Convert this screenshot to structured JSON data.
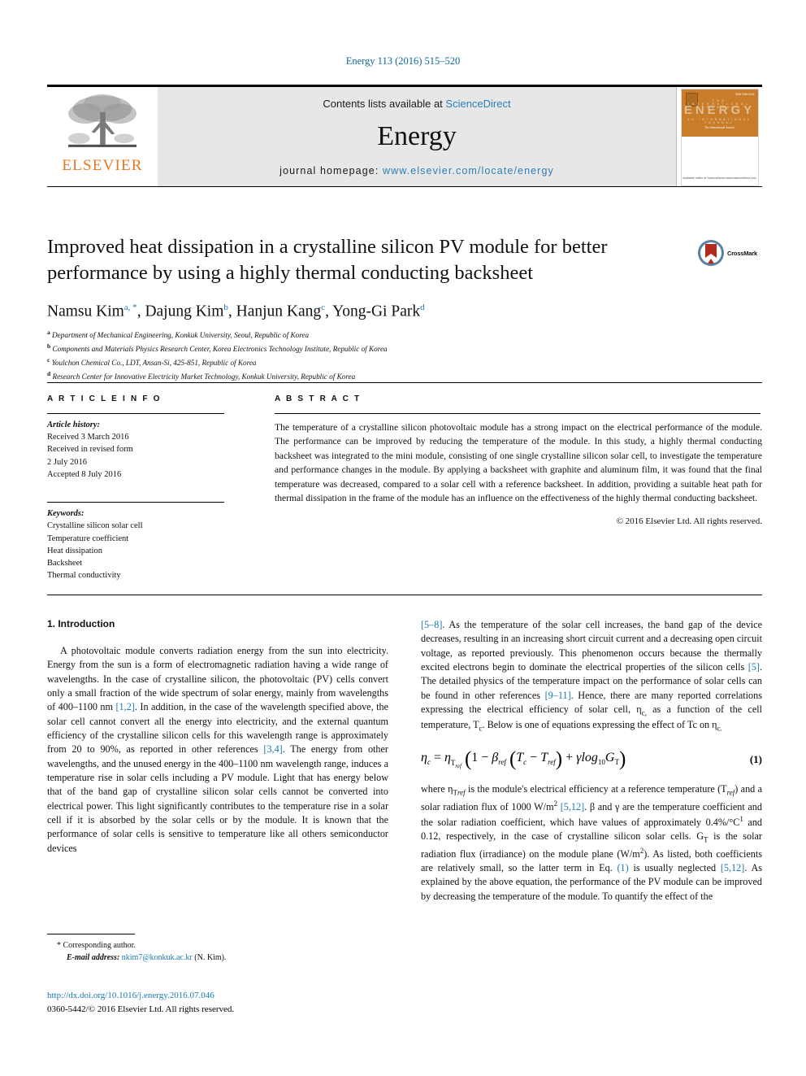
{
  "running_head": "Energy 113 (2016) 515–520",
  "masthead": {
    "publisher_name": "ELSEVIER",
    "contents_prefix": "Contents lists available at ",
    "contents_link": "ScienceDirect",
    "journal_title": "Energy",
    "homepage_prefix": "journal homepage: ",
    "homepage_link": "www.elsevier.com/locate/energy",
    "cover": {
      "wordmark": "ENERGY",
      "issn": "ISSN 0360-5442",
      "top_labels": "THE INTERNATIONAL JOURNAL",
      "bottom_labels": "AN INTERNATIONAL JOURNAL",
      "tagline": "The International Journal",
      "publisher_footer": "Available online at\nScienceDirect\nwww.sciencedirect.com"
    }
  },
  "title": "Improved heat dissipation in a crystalline silicon PV module for better performance by using a highly thermal conducting backsheet",
  "crossmark_label": "CrossMark",
  "authors": [
    {
      "name": "Namsu Kim",
      "sup": "a, *"
    },
    {
      "name": "Dajung Kim",
      "sup": "b"
    },
    {
      "name": "Hanjun Kang",
      "sup": "c"
    },
    {
      "name": "Yong-Gi Park",
      "sup": "d"
    }
  ],
  "affiliations": [
    {
      "mark": "a",
      "text": "Department of Mechanical Engineering, Konkuk University, Seoul, Republic of Korea"
    },
    {
      "mark": "b",
      "text": "Components and Materials Physics Research Center, Korea Electronics Technology Institute, Republic of Korea"
    },
    {
      "mark": "c",
      "text": "Youlchon Chemical Co., LDT, Ansan-Si, 425-851, Republic of Korea"
    },
    {
      "mark": "d",
      "text": "Research Center for Innovative Electricity Market Technology, Konkuk University, Republic of Korea"
    }
  ],
  "article_info": {
    "heading": "A R T I C L E   I N F O",
    "history_label": "Article history:",
    "history": [
      "Received 3 March 2016",
      "Received in revised form",
      "2 July 2016",
      "Accepted 8 July 2016"
    ],
    "keywords_label": "Keywords:",
    "keywords": [
      "Crystalline silicon solar cell",
      "Temperature coefficient",
      "Heat dissipation",
      "Backsheet",
      "Thermal conductivity"
    ]
  },
  "abstract": {
    "heading": "A B S T R A C T",
    "text": "The temperature of a crystalline silicon photovoltaic module has a strong impact on the electrical performance of the module. The performance can be improved by reducing the temperature of the module. In this study, a highly thermal conducting backsheet was integrated to the mini module, consisting of one single crystalline silicon solar cell, to investigate the temperature and performance changes in the module. By applying a backsheet with graphite and aluminum film, it was found that the final temperature was decreased, compared to a solar cell with a reference backsheet. In addition, providing a suitable heat path for thermal dissipation in the frame of the module has an influence on the effectiveness of the highly thermal conducting backsheet.",
    "copyright": "© 2016 Elsevier Ltd. All rights reserved."
  },
  "sections": {
    "intro_heading": "1. Introduction",
    "left_para_1": "A photovoltaic module converts radiation energy from the sun into electricity. Energy from the sun is a form of electromagnetic radiation having a wide range of wavelengths. In the case of crystalline silicon, the photovoltaic (PV) cells convert only a small fraction of the wide spectrum of solar energy, mainly from wavelengths of 400–1100 nm ",
    "ref_1_2": "[1,2]",
    "left_para_1b": ". In addition, in the case of the wavelength specified above, the solar cell cannot convert all the energy into electricity, and the external quantum efficiency of the crystalline silicon cells for this wavelength range is approximately from 20 to 90%, as reported in other references ",
    "ref_3_4": "[3,4]",
    "left_para_1c": ". The energy from other wavelengths, and the unused energy in the 400–1100 nm wavelength range, induces a temperature rise in solar cells including a PV module. Light that has energy below that of the band gap of crystalline silicon solar cells cannot be converted into electrical power. This light significantly contributes to the temperature rise in a solar cell if it is absorbed by the solar cells or by the module. It is known that the performance of solar cells is sensitive to temperature like all others semiconductor devices",
    "ref_5_8": "[5–8]",
    "right_para_1": ". As the temperature of the solar cell increases, the band gap of the device decreases, resulting in an increasing short circuit current and a decreasing open circuit voltage, as reported previously. This phenomenon occurs because the thermally excited electrons begin to dominate the electrical properties of the silicon cells ",
    "ref_5": "[5]",
    "right_para_1b": ". The detailed physics of the temperature impact on the performance of solar cells can be found in other references ",
    "ref_9_11": "[9–11]",
    "right_para_1c": ". Hence, there are many reported correlations expressing the electrical efficiency of solar cell, η",
    "right_para_1d": " as a function of the cell temperature, T",
    "right_para_1e": ". Below is one of equations expressing the effect of Tc on η",
    "equation_number": "(1)",
    "right_para_2a": "where η",
    "right_para_2b": " is the module's electrical efficiency at a reference temperature (T",
    "right_para_2c": ") and a solar radiation flux of 1000 W/m",
    "ref_5_12": "[5,12]",
    "right_para_2d": ". β and γ are the temperature coefficient and the solar radiation coefficient, which have values of approximately 0.4%/°C",
    "right_para_2e": " and 0.12, respectively, in the case of crystalline silicon solar cells. G",
    "right_para_2f": " is the solar radiation flux (irradiance) on the module plane (W/m",
    "right_para_2g": "). As listed, both coefficients are relatively small, so the latter term in Eq. ",
    "ref_eq1": "(1)",
    "right_para_2h": " is usually neglected ",
    "right_para_2i": ". As explained by the above equation, the performance of the PV module can be improved by decreasing the temperature of the module. To quantify the effect of the"
  },
  "footnote": {
    "corresponding": "* Corresponding author.",
    "email_label": "E-mail address:",
    "email": "nkim7@konkuk.ac.kr",
    "email_suffix": "(N. Kim)."
  },
  "doi": {
    "url": "http://dx.doi.org/10.1016/j.energy.2016.07.046",
    "issn_line": "0360-5442/© 2016 Elsevier Ltd. All rights reserved."
  },
  "colors": {
    "link": "#1a7ab3",
    "elsevier_orange": "#E87722",
    "band_gray": "#e7e7e7",
    "crossmark_red": "#b42a1e",
    "crossmark_blue": "#5b7f9e"
  }
}
